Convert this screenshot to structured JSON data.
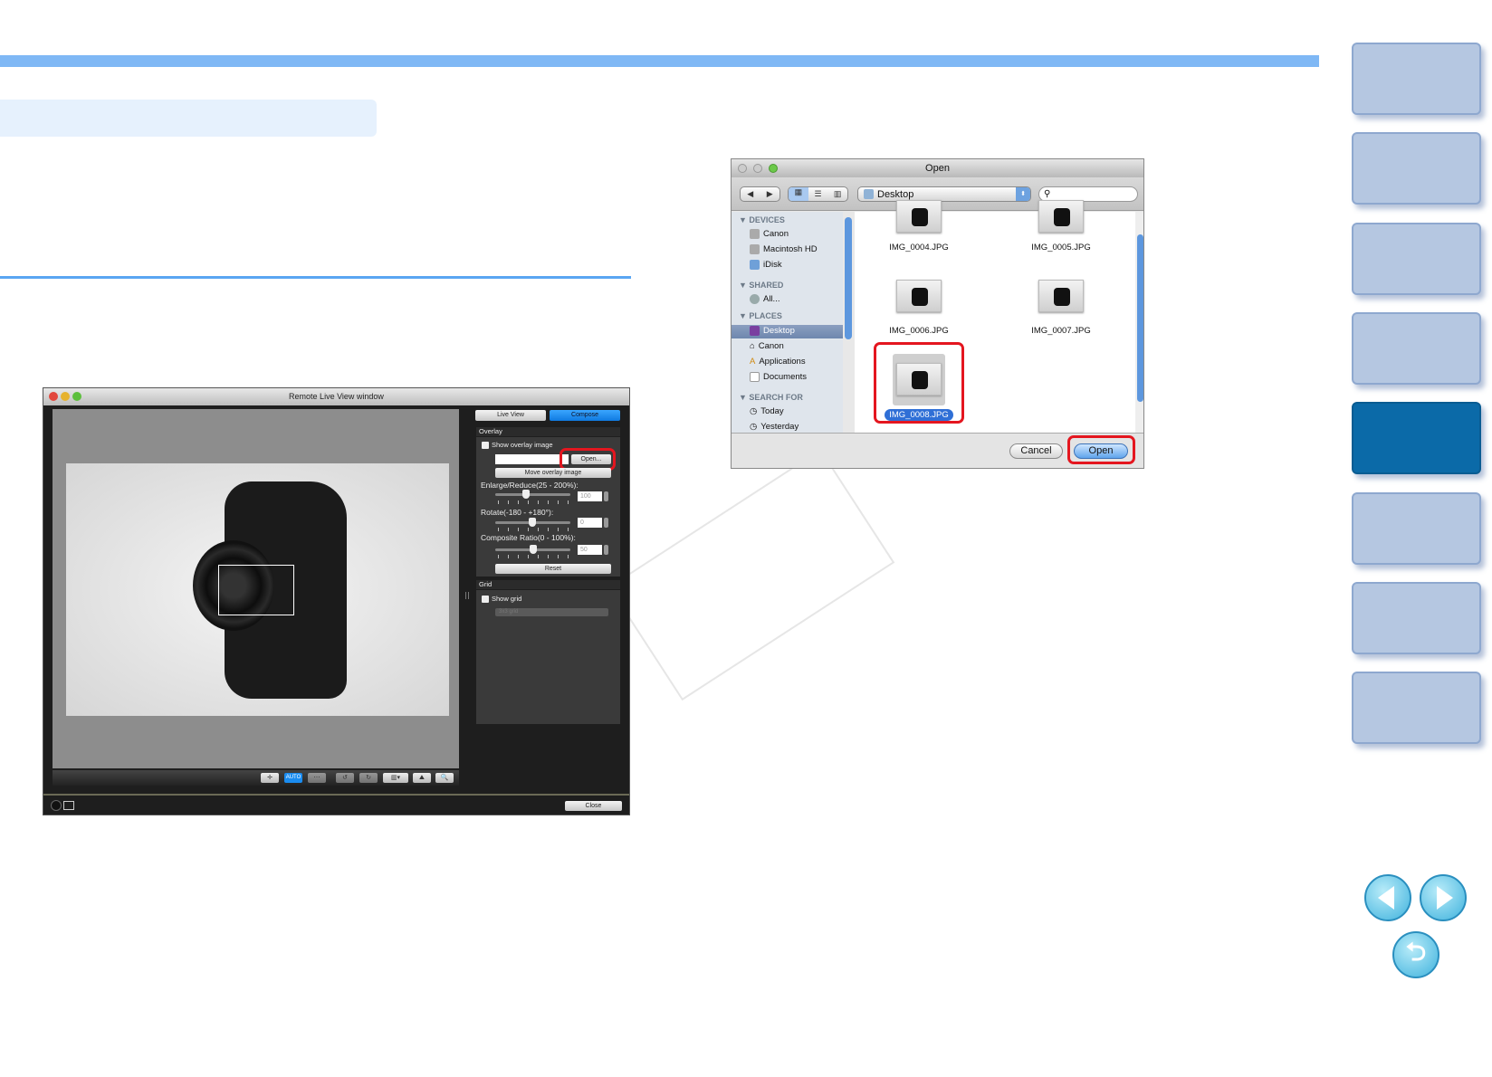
{
  "remote_window": {
    "title": "Remote Live View window",
    "tabs": [
      {
        "label": "Live View",
        "active": false
      },
      {
        "label": "Compose",
        "active": true
      }
    ],
    "overlay": {
      "header": "Overlay",
      "show_overlay_label": "Show overlay image",
      "open_button": "Open...",
      "move_button": "Move overlay image",
      "enlarge_label": "Enlarge/Reduce(25 - 200%):",
      "enlarge_value": "100",
      "rotate_label": "Rotate(-180 - +180°):",
      "rotate_value": "0",
      "composite_label": "Composite Ratio(0 - 100%):",
      "composite_value": "50",
      "reset_button": "Reset"
    },
    "grid": {
      "header": "Grid",
      "show_grid_label": "Show grid",
      "grid_select": "3x3 grid"
    },
    "toolbar": {
      "auto_label": "AUTO"
    },
    "close_button": "Close",
    "accent": "#1a8cf0"
  },
  "open_dialog": {
    "title": "Open",
    "location": "Desktop",
    "sidebar": [
      {
        "header": "DEVICES",
        "items": [
          "Canon",
          "Macintosh HD",
          "iDisk"
        ]
      },
      {
        "header": "SHARED",
        "items": [
          "All..."
        ]
      },
      {
        "header": "PLACES",
        "items": [
          "Desktop",
          "Canon",
          "Applications",
          "Documents"
        ]
      },
      {
        "header": "SEARCH FOR",
        "items": [
          "Today",
          "Yesterday"
        ]
      }
    ],
    "selected_sidebar": "Desktop",
    "files": [
      "IMG_0004.JPG",
      "IMG_0005.JPG",
      "IMG_0006.JPG",
      "IMG_0007.JPG",
      "IMG_0008.JPG"
    ],
    "selected_file": "IMG_0008.JPG",
    "cancel_button": "Cancel",
    "open_button": "Open"
  },
  "side_tabs": {
    "count": 8,
    "active_index": 4,
    "color": "#b5c7e1",
    "active_color": "#0b6aa8"
  },
  "colors": {
    "highlight": "#e4161f",
    "header_bar": "#7fb8f5"
  }
}
